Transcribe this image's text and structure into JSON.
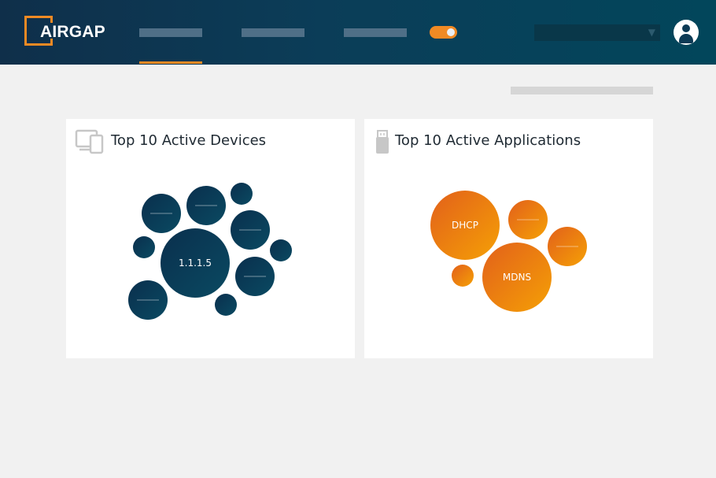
{
  "header": {
    "logo_text": "AIRGAP",
    "nav_items": [
      "",
      "",
      ""
    ],
    "active_nav_index": 0,
    "toggle": {
      "on": true
    },
    "select": {
      "value": "",
      "caret_icon": "chevron-down-icon"
    },
    "avatar_icon": "user-avatar-icon"
  },
  "colors": {
    "header_start": "#0f2f4a",
    "header_end": "#02465b",
    "accent": "#f08a24",
    "device_bubble": "#0b4059",
    "app_bubble": "#ee7d1a"
  },
  "panels": [
    {
      "title": "Top 10 Active Devices",
      "icon": "devices-icon",
      "bubbles": [
        {
          "label": "1.1.1.5"
        },
        {
          "label": ""
        },
        {
          "label": ""
        },
        {
          "label": ""
        },
        {
          "label": ""
        },
        {
          "label": ""
        },
        {
          "label": ""
        },
        {
          "label": ""
        },
        {
          "label": ""
        },
        {
          "label": ""
        }
      ]
    },
    {
      "title": "Top 10 Active Applications",
      "icon": "usb-stick-icon",
      "bubbles": [
        {
          "label": "DHCP"
        },
        {
          "label": "MDNS"
        },
        {
          "label": ""
        },
        {
          "label": ""
        },
        {
          "label": ""
        }
      ]
    }
  ]
}
